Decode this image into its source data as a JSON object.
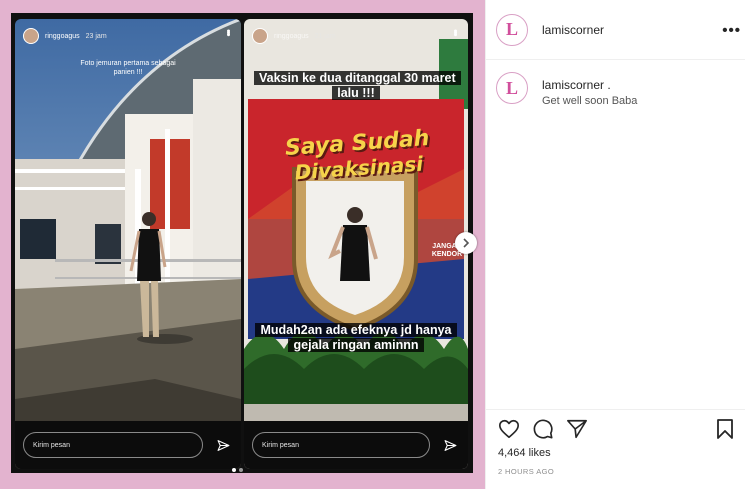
{
  "post": {
    "account": "lamiscorner",
    "more_label": "•••",
    "avatar_letter": "L",
    "comment": {
      "author": "lamiscorner .",
      "text": "Get well soon Baba"
    },
    "likes": "4,464 likes",
    "time": "2 HOURS AGO"
  },
  "stories": {
    "left": {
      "username": "ringgoagus",
      "time": "23 jam",
      "caption": "Foto jemuran pertama sebagai panien !!!",
      "reply_placeholder": "Kirim pesan"
    },
    "right": {
      "username": "ringgoagus",
      "time": "21 jam",
      "text_top": "Vaksin ke dua ditanggal 30 maret lalu !!!",
      "banner_line1": "Saya Sudah",
      "banner_line2": "Divaksinasi",
      "side_text": "JANGAN KENDOR",
      "text_bottom": "Mudah2an ada efeknya jd hanya gejala ringan aminnn",
      "reply_placeholder": "Kirim pesan"
    }
  },
  "colors": {
    "border_pink": "#e3b3cf",
    "banner_red": "#c9252c",
    "brand_pink": "#d14f9c"
  }
}
